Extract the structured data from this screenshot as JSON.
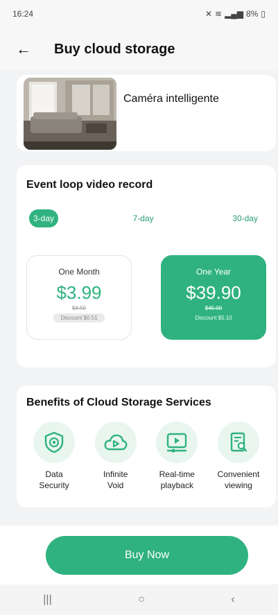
{
  "status_bar": {
    "time": "16:24",
    "battery": "8%"
  },
  "header": {
    "title": "Buy cloud storage",
    "back_icon": "arrow-left-icon"
  },
  "device": {
    "name": "Caméra intelligente"
  },
  "event_loop": {
    "title": "Event loop video record",
    "tabs": [
      {
        "label": "3-day",
        "active": true
      },
      {
        "label": "7-day",
        "active": false
      },
      {
        "label": "30-day",
        "active": false
      }
    ],
    "plans": [
      {
        "name": "One Month",
        "price": "$3.99",
        "old_price": "$4.50",
        "discount": "Discount $0.51",
        "selected": false
      },
      {
        "name": "One Year",
        "price": "$39.90",
        "old_price": "$45.00",
        "discount": "Discount $5.10",
        "selected": true
      }
    ]
  },
  "benefits": {
    "title": "Benefits of Cloud Storage Services",
    "items": [
      {
        "label_line1": "Data",
        "label_line2": "Security",
        "icon": "shield-eye-icon"
      },
      {
        "label_line1": "Infinite",
        "label_line2": "Void",
        "icon": "cloud-play-icon"
      },
      {
        "label_line1": "Real-time",
        "label_line2": "playback",
        "icon": "video-play-icon"
      },
      {
        "label_line1": "Convenient",
        "label_line2": "viewing",
        "icon": "document-search-icon"
      }
    ]
  },
  "actions": {
    "buy_label": "Buy Now"
  },
  "nav": {
    "recent": "|||",
    "home": "○",
    "back": "‹"
  },
  "colors": {
    "accent": "#2fb27f",
    "accent_light": "#e8f6ef"
  }
}
